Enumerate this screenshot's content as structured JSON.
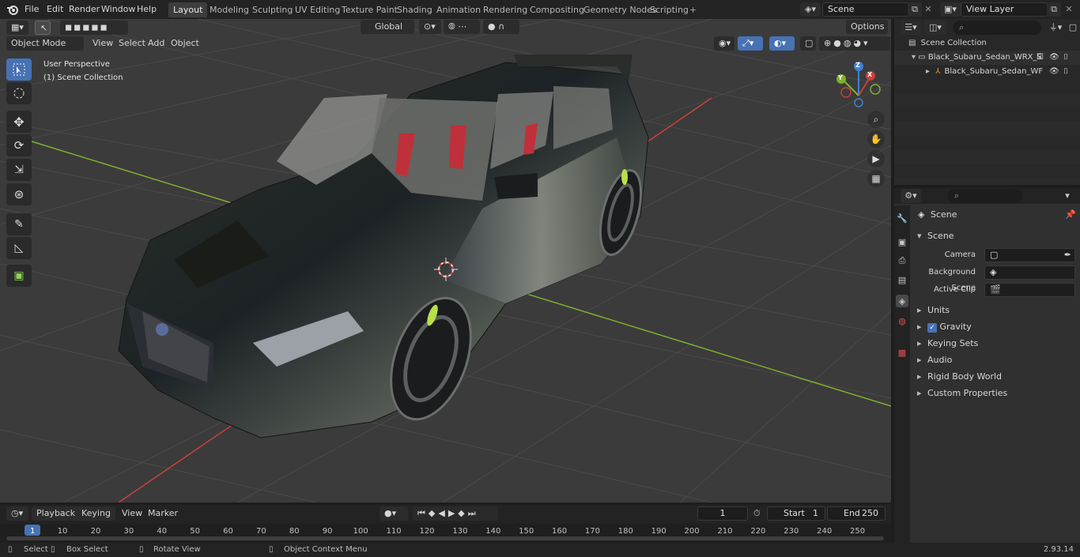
{
  "menubar": {
    "items": [
      "File",
      "Edit",
      "Render",
      "Window",
      "Help"
    ],
    "workspaces": [
      "Layout",
      "Modeling",
      "Sculpting",
      "UV Editing",
      "Texture Paint",
      "Shading",
      "Animation",
      "Rendering",
      "Compositing",
      "Geometry Nodes",
      "Scripting"
    ],
    "active_workspace": "Layout",
    "scene_field": "Scene",
    "view_layer_field": "View Layer"
  },
  "viewport": {
    "mode": "Object Mode",
    "menus": [
      "View",
      "Select",
      "Add",
      "Object"
    ],
    "transform_orientation": "Global",
    "options_label": "Options",
    "overlay_line1": "User Perspective",
    "overlay_line2": "(1) Scene Collection",
    "gizmo_axes": [
      "X",
      "Y",
      "Z"
    ]
  },
  "outliner": {
    "root": "Scene Collection",
    "items": [
      "Black_Subaru_Sedan_WRX_S",
      "Black_Subaru_Sedan_WF"
    ]
  },
  "properties": {
    "header": "Scene",
    "panel_title": "Scene",
    "fields": [
      {
        "label": "Camera",
        "value": ""
      },
      {
        "label": "Background Scene",
        "value": ""
      },
      {
        "label": "Active Clip",
        "value": ""
      }
    ],
    "subpanels": [
      "Units",
      "Gravity",
      "Keying Sets",
      "Audio",
      "Rigid Body World",
      "Custom Properties"
    ],
    "gravity_checked": true
  },
  "timeline": {
    "menus": [
      "Playback",
      "Keying",
      "View",
      "Marker"
    ],
    "current_frame": "1",
    "start_label": "Start",
    "start_value": "1",
    "end_label": "End",
    "end_value": "250",
    "ticks": [
      "1",
      "10",
      "20",
      "30",
      "40",
      "50",
      "60",
      "70",
      "80",
      "90",
      "100",
      "110",
      "120",
      "130",
      "140",
      "150",
      "160",
      "170",
      "180",
      "190",
      "200",
      "210",
      "220",
      "230",
      "240",
      "250"
    ]
  },
  "statusbar": {
    "select": "Select",
    "box_select": "Box Select",
    "rotate_view": "Rotate View",
    "context_menu": "Object Context Menu",
    "version": "2.93.14"
  },
  "colors": {
    "accent": "#4772b3",
    "x_axis": "#c9403b",
    "y_axis": "#7eb02f",
    "z_axis": "#3f82d8"
  }
}
